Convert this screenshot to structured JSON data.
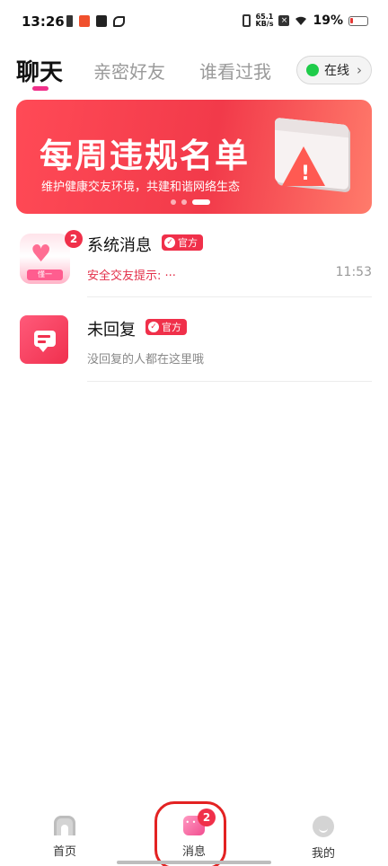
{
  "status_bar": {
    "time": "13:26",
    "net_speed_value": "65.1",
    "net_speed_unit": "KB/s",
    "battery": "19%"
  },
  "top_tabs": {
    "tabs": [
      {
        "label": "聊天",
        "active": true
      },
      {
        "label": "亲密好友",
        "active": false
      },
      {
        "label": "谁看过我",
        "active": false
      }
    ],
    "online_label": "在线"
  },
  "banner": {
    "title": "每周违规名单",
    "subtitle": "维护健康交友环境，共建和谐网络生态",
    "page_count": 3,
    "active_page": 3
  },
  "chat_list": [
    {
      "title": "系统消息",
      "official_label": "官方",
      "preview": "安全交友提示: ···",
      "time": "11:53",
      "badge": "2",
      "avatar_tag": "懂一"
    },
    {
      "title": "未回复",
      "official_label": "官方",
      "preview": "没回复的人都在这里哦",
      "time": "",
      "badge": ""
    }
  ],
  "bottom_nav": {
    "items": [
      {
        "label": "首页",
        "icon": "home-icon"
      },
      {
        "label": "消息",
        "icon": "message-icon",
        "badge": "2"
      },
      {
        "label": "我的",
        "icon": "profile-icon"
      }
    ]
  },
  "colors": {
    "accent": "#f0304a",
    "tab_indicator": "#f0308a",
    "online_green": "#1fcc4a"
  }
}
